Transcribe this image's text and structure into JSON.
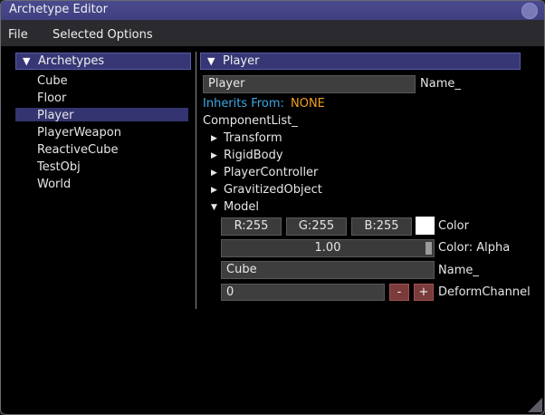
{
  "window": {
    "title": "Archetype Editor"
  },
  "menu": {
    "file": "File",
    "selected_options": "Selected Options"
  },
  "archetypes": {
    "header": "Archetypes",
    "items": [
      "Cube",
      "Floor",
      "Player",
      "PlayerWeapon",
      "ReactiveCube",
      "TestObj",
      "World"
    ],
    "selected": "Player"
  },
  "inspector": {
    "header": "Player",
    "name_value": "Player",
    "name_label": "Name_",
    "inherits_label": "Inherits From:",
    "inherits_value": "NONE",
    "component_list_label": "ComponentList_",
    "components": [
      "Transform",
      "RigidBody",
      "PlayerController",
      "GravitizedObject",
      "Model"
    ],
    "model": {
      "r": "R:255",
      "g": "G:255",
      "b": "B:255",
      "color_label": "Color",
      "swatch_color": "#ffffff",
      "alpha_value": "1.00",
      "alpha_label": "Color: Alpha",
      "mesh_value": "Cube",
      "mesh_label": "Name_",
      "deform_value": "0",
      "minus": "-",
      "plus": "+",
      "deform_label": "DeformChannel"
    }
  },
  "colors": {
    "title_bar": "#3f3f80",
    "header_bg": "#373776",
    "selection": "#343470",
    "inherits_blue": "#3fa8e6",
    "inherits_orange": "#f0a020"
  }
}
